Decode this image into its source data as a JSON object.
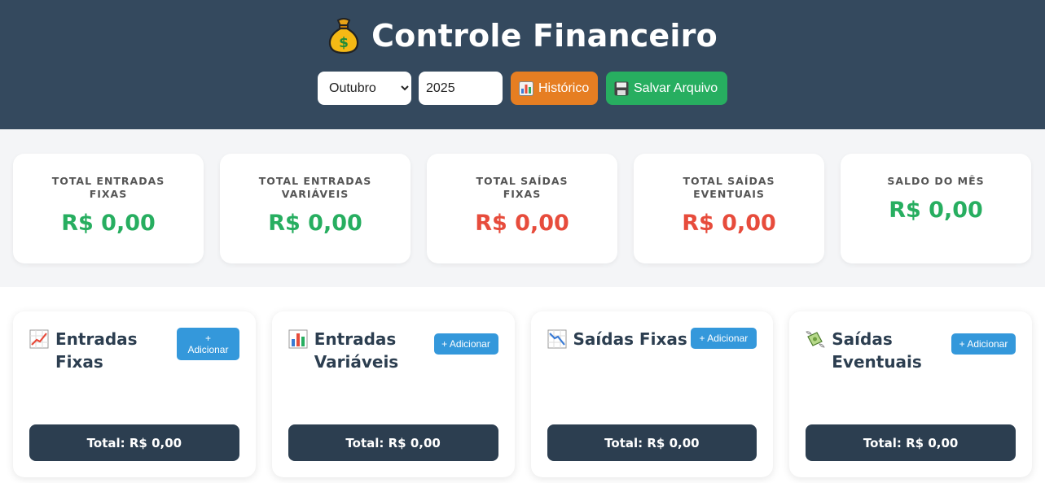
{
  "header": {
    "title": "Controle Financeiro",
    "icon": "money-bag-icon",
    "month_value": "Outubro",
    "year_value": "2025",
    "history_label": "Histórico",
    "save_label": "Salvar Arquivo"
  },
  "summary": [
    {
      "label": "Total Entradas Fixas",
      "value": "R$ 0,00",
      "color": "#27ae60"
    },
    {
      "label": "Total Entradas Variáveis",
      "value": "R$ 0,00",
      "color": "#27ae60"
    },
    {
      "label": "Total Saídas Fixas",
      "value": "R$ 0,00",
      "color": "#e74c3c"
    },
    {
      "label": "Total Saídas Eventuais",
      "value": "R$ 0,00",
      "color": "#e74c3c"
    },
    {
      "label": "Saldo do Mês",
      "value": "R$ 0,00",
      "color": "#27ae60"
    }
  ],
  "panels": [
    {
      "title": "Entradas Fixas",
      "icon": "chart-increasing-icon",
      "add_label": "+ Adicionar",
      "total": "Total: R$ 0,00"
    },
    {
      "title": "Entradas Variáveis",
      "icon": "bar-chart-icon",
      "add_label": "+ Adicionar",
      "total": "Total: R$ 0,00"
    },
    {
      "title": "Saídas Fixas",
      "icon": "chart-decreasing-icon",
      "add_label": "+ Adicionar",
      "total": "Total: R$ 0,00"
    },
    {
      "title": "Saídas Eventuais",
      "icon": "money-with-wings-icon",
      "add_label": "+ Adicionar",
      "total": "Total: R$ 0,00"
    }
  ],
  "colors": {
    "header": "#34495e",
    "orange": "#e67e22",
    "green": "#27ae60",
    "blue": "#3498db",
    "red": "#e74c3c"
  }
}
